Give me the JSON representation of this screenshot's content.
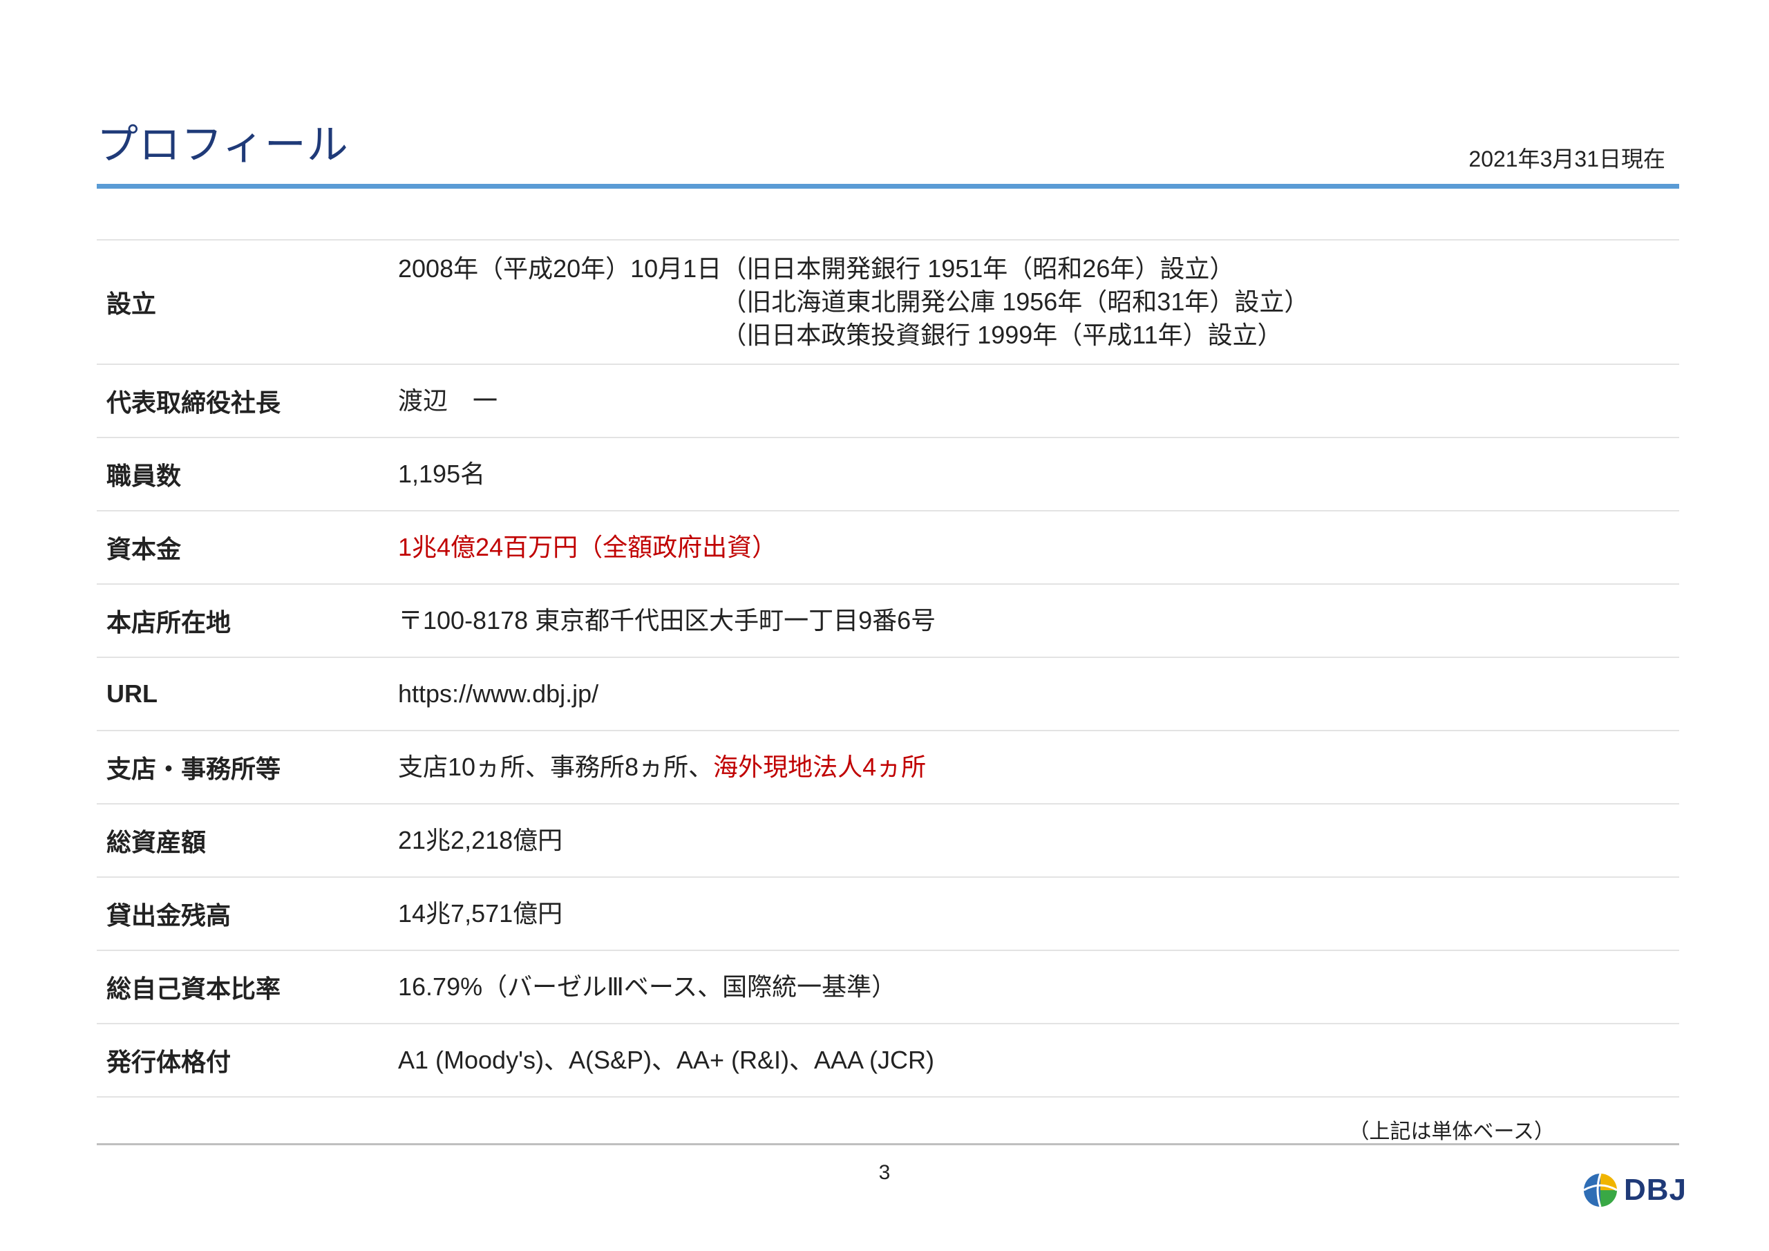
{
  "header": {
    "title": "プロフィール",
    "date": "2021年3月31日現在"
  },
  "profile": {
    "establishment": {
      "label": "設立",
      "date": "2008年（平成20年）10月1日",
      "history": [
        "（旧日本開発銀行 1951年（昭和26年）設立）",
        "（旧北海道東北開発公庫 1956年（昭和31年）設立）",
        "（旧日本政策投資銀行 1999年（平成11年）設立）"
      ]
    },
    "ceo": {
      "label": "代表取締役社長",
      "value": "渡辺　一"
    },
    "employees": {
      "label": "職員数",
      "value": "1,195名"
    },
    "capital": {
      "label": "資本金",
      "value": "1兆4億24百万円（全額政府出資）"
    },
    "head_office": {
      "label": "本店所在地",
      "value": "〒100-8178 東京都千代田区大手町一丁目9番6号"
    },
    "url": {
      "label": "URL",
      "value": "https://www.dbj.jp/"
    },
    "branches": {
      "label": "支店・事務所等",
      "value_plain": "支店10ヵ所、事務所8ヵ所、",
      "value_red": "海外現地法人4ヵ所"
    },
    "total_assets": {
      "label": "総資産額",
      "value": "21兆2,218億円"
    },
    "loans": {
      "label": "貸出金残高",
      "value": "14兆7,571億円"
    },
    "capital_ratio": {
      "label": "総自己資本比率",
      "value": "16.79%（バーゼルⅢベース、国際統一基準）"
    },
    "ratings": {
      "label": "発行体格付",
      "value": "A1 (Moody's)、A(S&P)、AA+ (R&I)、AAA (JCR)"
    }
  },
  "note": "（上記は単体ベース）",
  "footer": {
    "page_number": "3",
    "logo_text": "DBJ"
  },
  "colors": {
    "title": "#1f3a78",
    "rule": "#5a9bd5",
    "highlight": "#c00000"
  }
}
